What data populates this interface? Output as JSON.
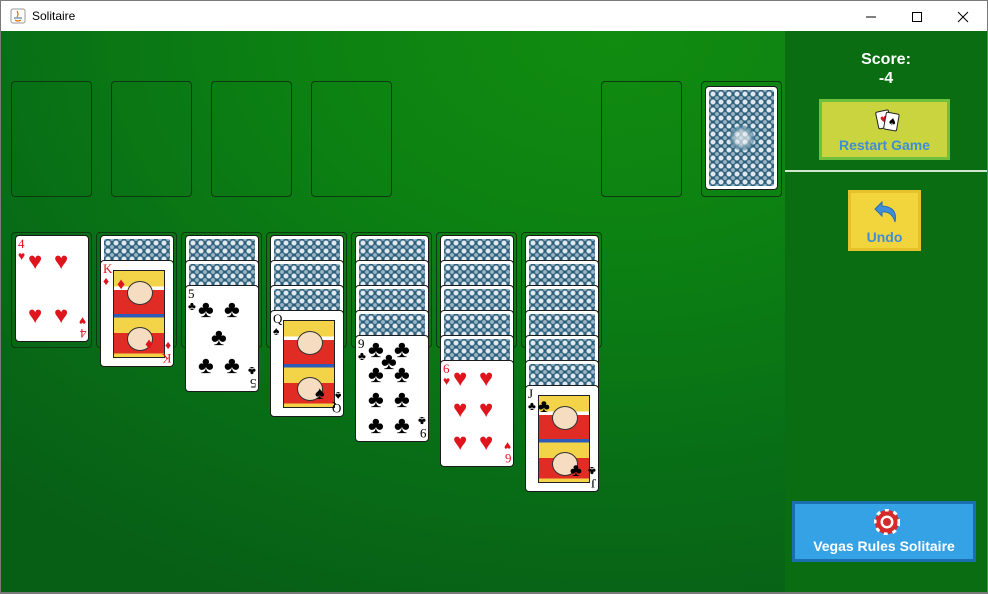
{
  "window": {
    "title": "Solitaire",
    "controls": {
      "minimize": "minimize-icon",
      "maximize": "maximize-icon",
      "close": "close-icon"
    }
  },
  "foundations": [
    {
      "state": "empty"
    },
    {
      "state": "empty"
    },
    {
      "state": "empty"
    },
    {
      "state": "empty"
    }
  ],
  "waste": {
    "state": "empty"
  },
  "stock": {
    "state": "face-down"
  },
  "tableau": [
    {
      "face_down": 0,
      "top": {
        "rank": "4",
        "suit": "♥",
        "color": "red"
      }
    },
    {
      "face_down": 1,
      "top": {
        "rank": "K",
        "suit": "♦",
        "color": "red"
      }
    },
    {
      "face_down": 2,
      "top": {
        "rank": "5",
        "suit": "♣",
        "color": "black"
      }
    },
    {
      "face_down": 3,
      "top": {
        "rank": "Q",
        "suit": "♠",
        "color": "black"
      }
    },
    {
      "face_down": 4,
      "top": {
        "rank": "9",
        "suit": "♣",
        "color": "black"
      }
    },
    {
      "face_down": 5,
      "top": {
        "rank": "6",
        "suit": "♥",
        "color": "red"
      }
    },
    {
      "face_down": 6,
      "top": {
        "rank": "J",
        "suit": "♣",
        "color": "black"
      }
    }
  ],
  "sidebar": {
    "score_label": "Score:",
    "score_value": "-4",
    "restart_label": "Restart Game",
    "undo_label": "Undo",
    "vegas_label": "Vegas Rules Solitaire"
  },
  "colors": {
    "felt": "#0c8112",
    "sidebar": "#0b6d12",
    "restart_bg": "#c9d43f",
    "undo_bg": "#f2d53c",
    "vegas_bg": "#36a2e6",
    "button_text": "#3e8fd6",
    "red_suit": "#e0141d"
  }
}
